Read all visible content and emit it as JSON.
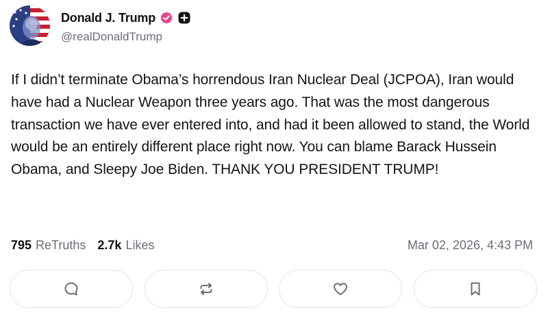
{
  "author": {
    "display_name": "Donald J. Trump",
    "handle": "@realDonaldTrump",
    "verified_badge_icon": "verified-check-icon",
    "verified_badge_color": "#e8458b",
    "extra_badge_icon": "plus-square-icon"
  },
  "post": {
    "text": "If I didn’t terminate Obama’s horrendous Iran Nuclear Deal (JCPOA), Iran would have had a Nuclear Weapon three years ago. That was the most dangerous transaction we have ever entered into, and had it been allowed to stand, the World would be an entirely different place right now. You can blame Barack Hussein Obama, and Sleepy Joe Biden. THANK YOU PRESIDENT TRUMP!"
  },
  "stats": {
    "retruths_count": "795",
    "retruths_label": "ReTruths",
    "likes_count": "2.7k",
    "likes_label": "Likes",
    "timestamp": "Mar 02, 2026, 4:43 PM"
  },
  "actions": [
    {
      "name": "reply",
      "icon": "comment-bubble-icon"
    },
    {
      "name": "retruth",
      "icon": "repost-arrows-icon"
    },
    {
      "name": "like",
      "icon": "heart-icon"
    },
    {
      "name": "bookmark",
      "icon": "bookmark-icon"
    }
  ],
  "colors": {
    "text": "#141414",
    "muted": "#6b6b78",
    "button_border": "#e4e4ea",
    "icon": "#6b6b78"
  }
}
